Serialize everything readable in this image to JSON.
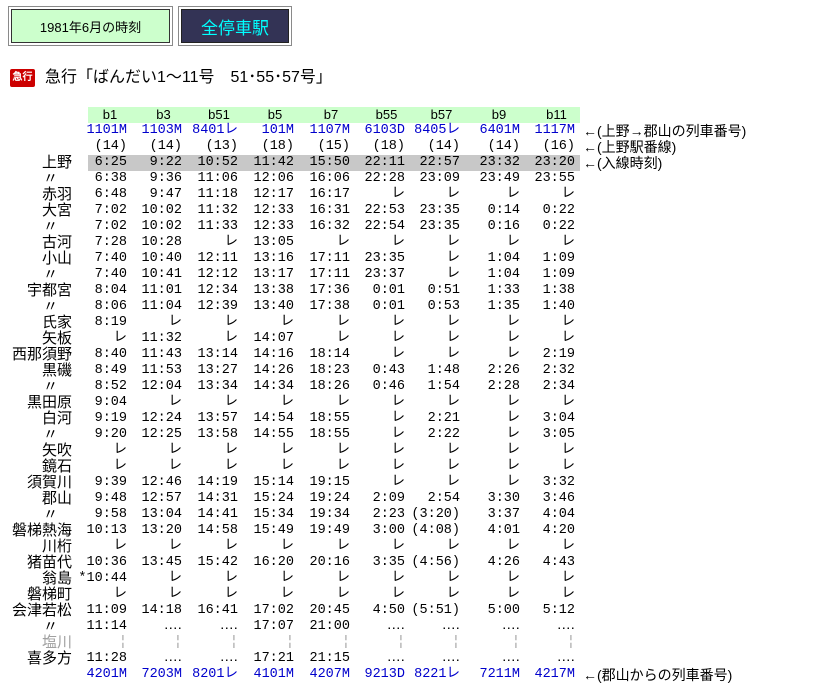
{
  "colors": {
    "header_green": "#ccffcc",
    "highlight_gray": "#c8c8c8",
    "train_number_blue": "#0000cc",
    "button_dark": "#333355",
    "button_text_cyan": "#00ffff",
    "icon_red": "#cc0000",
    "greyed_text": "#a0a0a0"
  },
  "header": {
    "period_label": "1981年6月の時刻",
    "all_stops_label": "全停車駅"
  },
  "title": {
    "icon": "急行",
    "text": "急行「ばんだい1～11号　51･55･57号」"
  },
  "timetable": {
    "columns": [
      "b1",
      "b3",
      "b51",
      "b5",
      "b7",
      "b55",
      "b57",
      "b9",
      "b11"
    ],
    "train_numbers_to_koriyama": {
      "values": [
        "1101M",
        "1103M",
        "8401レ",
        "101M",
        "1107M",
        "6103D",
        "8405レ",
        "6401M",
        "1117M"
      ],
      "note": "←(上野→郡山の列車番号)"
    },
    "ueno_platforms": {
      "values": [
        "(14)",
        "(14)",
        "(13)",
        "(18)",
        "(15)",
        "(18)",
        "(14)",
        "(14)",
        "(16)"
      ],
      "note": "←(上野駅番線)"
    },
    "stations": [
      {
        "name": "上野",
        "highlighted": true,
        "times": [
          "6:25",
          "9:22",
          "10:52",
          "11:42",
          "15:50",
          "22:11",
          "22:57",
          "23:32",
          "23:20"
        ],
        "note": "←(入線時刻)"
      },
      {
        "name": "〃",
        "times": [
          "6:38",
          "9:36",
          "11:06",
          "12:06",
          "16:06",
          "22:28",
          "23:09",
          "23:49",
          "23:55"
        ]
      },
      {
        "name": "赤羽",
        "times": [
          "6:48",
          "9:47",
          "11:18",
          "12:17",
          "16:17",
          "レ",
          "レ",
          "レ",
          "レ"
        ]
      },
      {
        "name": "大宮",
        "times": [
          "7:02",
          "10:02",
          "11:32",
          "12:33",
          "16:31",
          "22:53",
          "23:35",
          "0:14",
          "0:22"
        ]
      },
      {
        "name": "〃",
        "times": [
          "7:02",
          "10:02",
          "11:33",
          "12:33",
          "16:32",
          "22:54",
          "23:35",
          "0:16",
          "0:22"
        ]
      },
      {
        "name": "古河",
        "times": [
          "7:28",
          "10:28",
          "レ",
          "13:05",
          "レ",
          "レ",
          "レ",
          "レ",
          "レ"
        ]
      },
      {
        "name": "小山",
        "times": [
          "7:40",
          "10:40",
          "12:11",
          "13:16",
          "17:11",
          "23:35",
          "レ",
          "1:04",
          "1:09"
        ]
      },
      {
        "name": "〃",
        "times": [
          "7:40",
          "10:41",
          "12:12",
          "13:17",
          "17:11",
          "23:37",
          "レ",
          "1:04",
          "1:09"
        ]
      },
      {
        "name": "宇都宮",
        "times": [
          "8:04",
          "11:01",
          "12:34",
          "13:38",
          "17:36",
          "0:01",
          "0:51",
          "1:33",
          "1:38"
        ]
      },
      {
        "name": "〃",
        "times": [
          "8:06",
          "11:04",
          "12:39",
          "13:40",
          "17:38",
          "0:01",
          "0:53",
          "1:35",
          "1:40"
        ]
      },
      {
        "name": "氏家",
        "times": [
          "8:19",
          "レ",
          "レ",
          "レ",
          "レ",
          "レ",
          "レ",
          "レ",
          "レ"
        ]
      },
      {
        "name": "矢板",
        "times": [
          "レ",
          "11:32",
          "レ",
          "14:07",
          "レ",
          "レ",
          "レ",
          "レ",
          "レ"
        ]
      },
      {
        "name": "西那須野",
        "times": [
          "8:40",
          "11:43",
          "13:14",
          "14:16",
          "18:14",
          "レ",
          "レ",
          "レ",
          "2:19"
        ]
      },
      {
        "name": "黒磯",
        "times": [
          "8:49",
          "11:53",
          "13:27",
          "14:26",
          "18:23",
          "0:43",
          "1:48",
          "2:26",
          "2:32"
        ]
      },
      {
        "name": "〃",
        "times": [
          "8:52",
          "12:04",
          "13:34",
          "14:34",
          "18:26",
          "0:46",
          "1:54",
          "2:28",
          "2:34"
        ]
      },
      {
        "name": "黒田原",
        "times": [
          "9:04",
          "レ",
          "レ",
          "レ",
          "レ",
          "レ",
          "レ",
          "レ",
          "レ"
        ]
      },
      {
        "name": "白河",
        "times": [
          "9:19",
          "12:24",
          "13:57",
          "14:54",
          "18:55",
          "レ",
          "2:21",
          "レ",
          "3:04"
        ]
      },
      {
        "name": "〃",
        "times": [
          "9:20",
          "12:25",
          "13:58",
          "14:55",
          "18:55",
          "レ",
          "2:22",
          "レ",
          "3:05"
        ]
      },
      {
        "name": "矢吹",
        "times": [
          "レ",
          "レ",
          "レ",
          "レ",
          "レ",
          "レ",
          "レ",
          "レ",
          "レ"
        ]
      },
      {
        "name": "鏡石",
        "times": [
          "レ",
          "レ",
          "レ",
          "レ",
          "レ",
          "レ",
          "レ",
          "レ",
          "レ"
        ]
      },
      {
        "name": "須賀川",
        "times": [
          "9:39",
          "12:46",
          "14:19",
          "15:14",
          "19:15",
          "レ",
          "レ",
          "レ",
          "3:32"
        ]
      },
      {
        "name": "郡山",
        "times": [
          "9:48",
          "12:57",
          "14:31",
          "15:24",
          "19:24",
          "2:09",
          "2:54",
          "3:30",
          "3:46"
        ]
      },
      {
        "name": "〃",
        "times": [
          "9:58",
          "13:04",
          "14:41",
          "15:34",
          "19:34",
          "2:23",
          "(3:20)",
          "3:37",
          "4:04"
        ]
      },
      {
        "name": "磐梯熱海",
        "times": [
          "10:13",
          "13:20",
          "14:58",
          "15:49",
          "19:49",
          "3:00",
          "(4:08)",
          "4:01",
          "4:20"
        ]
      },
      {
        "name": "川桁",
        "times": [
          "レ",
          "レ",
          "レ",
          "レ",
          "レ",
          "レ",
          "レ",
          "レ",
          "レ"
        ]
      },
      {
        "name": "猪苗代",
        "times": [
          "10:36",
          "13:45",
          "15:42",
          "16:20",
          "20:16",
          "3:35",
          "(4:56)",
          "4:26",
          "4:43"
        ]
      },
      {
        "name": "翁島",
        "times": [
          "*10:44",
          "レ",
          "レ",
          "レ",
          "レ",
          "レ",
          "レ",
          "レ",
          "レ"
        ]
      },
      {
        "name": "磐梯町",
        "times": [
          "レ",
          "レ",
          "レ",
          "レ",
          "レ",
          "レ",
          "レ",
          "レ",
          "レ"
        ]
      },
      {
        "name": "会津若松",
        "times": [
          "11:09",
          "14:18",
          "16:41",
          "17:02",
          "20:45",
          "4:50",
          "(5:51)",
          "5:00",
          "5:12"
        ]
      },
      {
        "name": "〃",
        "times": [
          "11:14",
          "‥‥",
          "‥‥",
          "17:07",
          "21:00",
          "‥‥",
          "‥‥",
          "‥‥",
          "‥‥"
        ]
      },
      {
        "name": "塩川",
        "greyed": true,
        "times": [
          "¦",
          "¦",
          "¦",
          "¦",
          "¦",
          "¦",
          "¦",
          "¦",
          "¦"
        ]
      },
      {
        "name": "喜多方",
        "times": [
          "11:28",
          "‥‥",
          "‥‥",
          "17:21",
          "21:15",
          "‥‥",
          "‥‥",
          "‥‥",
          "‥‥"
        ]
      }
    ],
    "train_numbers_from_koriyama": {
      "values": [
        "4201M",
        "7203M",
        "8201レ",
        "4101M",
        "4207M",
        "9213D",
        "8221レ",
        "7211M",
        "4217M"
      ],
      "note": "←(郡山からの列車番号)"
    }
  }
}
